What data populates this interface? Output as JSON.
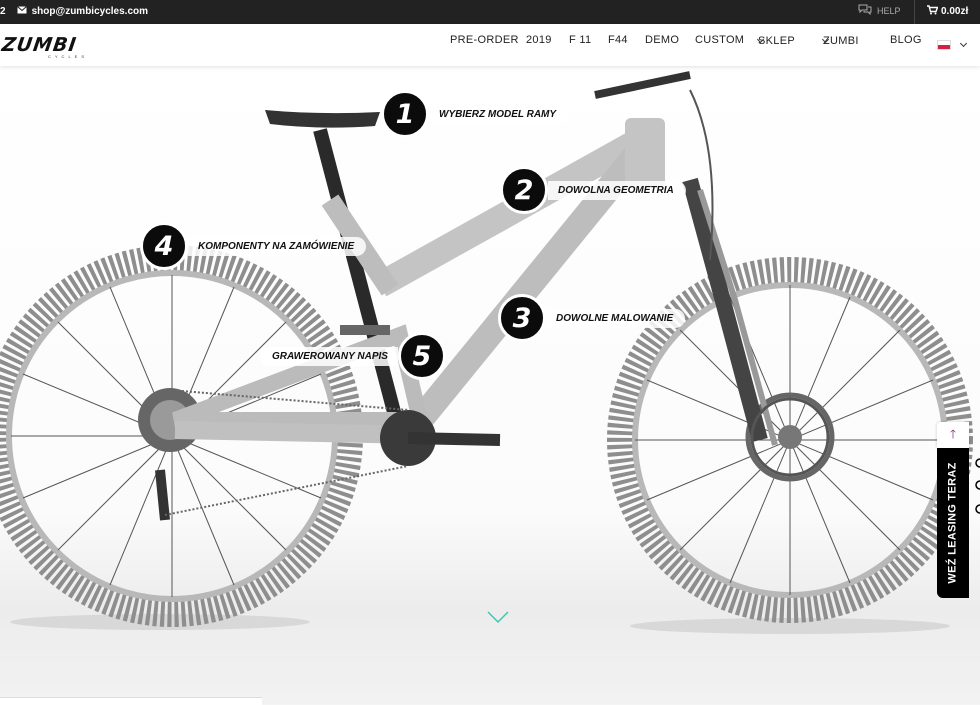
{
  "topbar": {
    "phone_fragment": "2",
    "email": "shop@zumbicycles.com",
    "help_label": "HELP",
    "cart_total": "0.00zł"
  },
  "header": {
    "logo": "ZUMBI",
    "logo_sub": "CYCLES",
    "menu": [
      {
        "label": "PRE-ORDER",
        "dropdown": false
      },
      {
        "label": "2019",
        "dropdown": false
      },
      {
        "label": "F 11",
        "dropdown": false
      },
      {
        "label": "F44",
        "dropdown": false
      },
      {
        "label": "DEMO",
        "dropdown": false
      },
      {
        "label": "CUSTOM",
        "dropdown": false
      },
      {
        "label": "SKLEP",
        "dropdown": true
      },
      {
        "label": "ZUMBI",
        "dropdown": true
      },
      {
        "label": "BLOG",
        "dropdown": false
      }
    ],
    "language_flag": "pl-flag-icon"
  },
  "hero": {
    "callouts": [
      {
        "number": "1",
        "label": "WYBIERZ MODEL RAMY"
      },
      {
        "number": "2",
        "label": "DOWOLNA GEOMETRIA"
      },
      {
        "number": "3",
        "label": "DOWOLNE MALOWANIE"
      },
      {
        "number": "4",
        "label": "KOMPONENTY NA ZAMÓWIENIE"
      },
      {
        "number": "5",
        "label": "GRAWEROWANY NAPIS"
      }
    ],
    "scroll_icon": "chevron-down-icon"
  },
  "leasing": {
    "label": "WEŹ LEASING TERAZ",
    "up_icon": "arrow-up-icon"
  },
  "colors": {
    "topbar_bg": "#222222",
    "badge_bg": "#0b0b0b",
    "leasing_bg": "#000000",
    "scroll_arrow": "#3fc6b0",
    "leasing_arrow": "#7a1f6b"
  }
}
